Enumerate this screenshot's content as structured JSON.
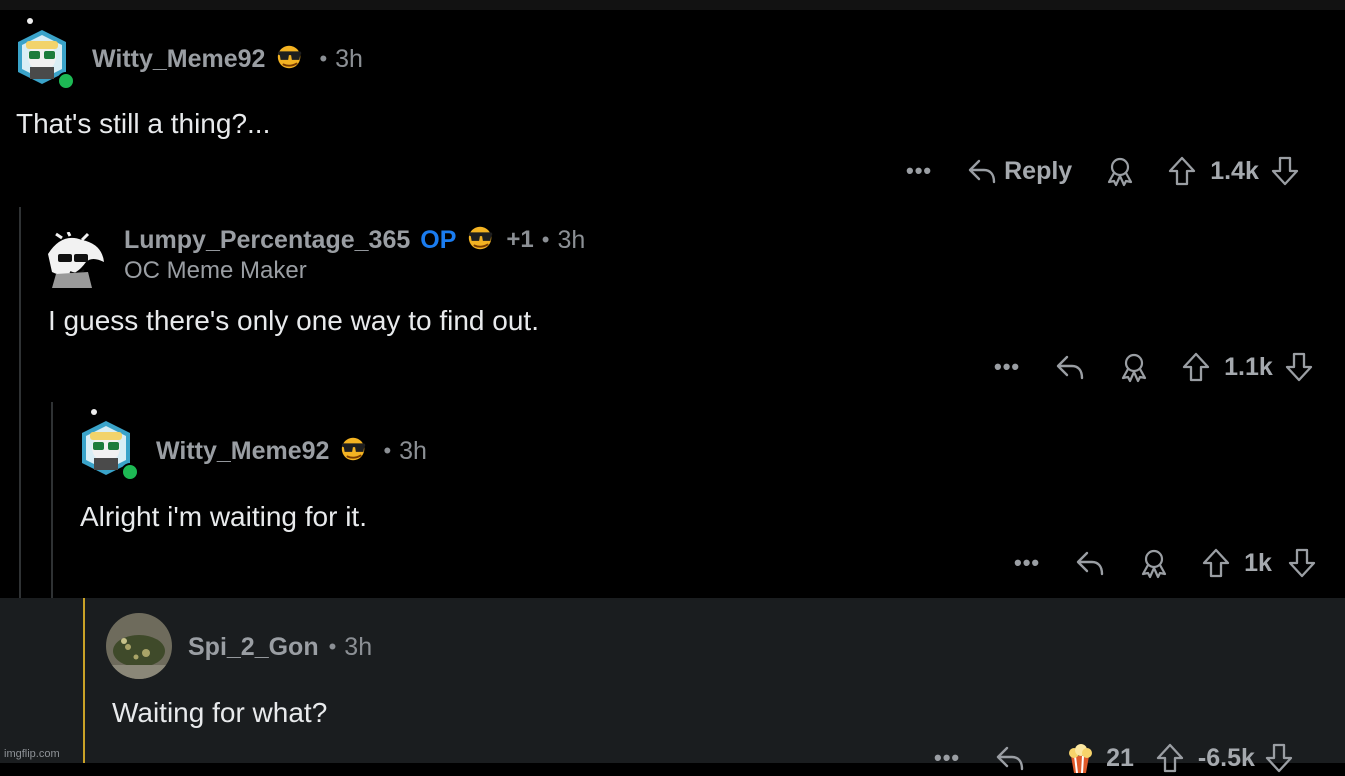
{
  "comments": [
    {
      "username": "Witty_Meme92",
      "time": "3h",
      "body": "That's still a thing?...",
      "reply_label": "Reply",
      "score": "1.4k",
      "more": "•••"
    },
    {
      "username": "Lumpy_Percentage_365",
      "op_badge": "OP",
      "plus": "+1",
      "time": "3h",
      "flair": "OC Meme Maker",
      "body": "I guess there's only one way to find out.",
      "score": "1.1k",
      "more": "•••"
    },
    {
      "username": "Witty_Meme92",
      "time": "3h",
      "body": "Alright i'm waiting for it.",
      "score": "1k",
      "more": "•••"
    },
    {
      "username": "Spi_2_Gon",
      "time": "3h",
      "body": "Waiting for what?",
      "award_count": "21",
      "score": "-6.5k",
      "more": "•••"
    }
  ],
  "watermark": "imgflip.com",
  "colors": {
    "background": "#000000",
    "highlight": "#1a1d1f",
    "op": "#1a7cf0",
    "thread_line": "#2f3234",
    "highlight_bar": "#c9a227"
  },
  "icons": [
    "snoo-avatar-icon",
    "online-dot-icon",
    "sunglasses-emoji-icon",
    "reply-arrow-icon",
    "award-icon",
    "upvote-icon",
    "downvote-icon",
    "more-options-icon",
    "popcorn-award-icon"
  ]
}
